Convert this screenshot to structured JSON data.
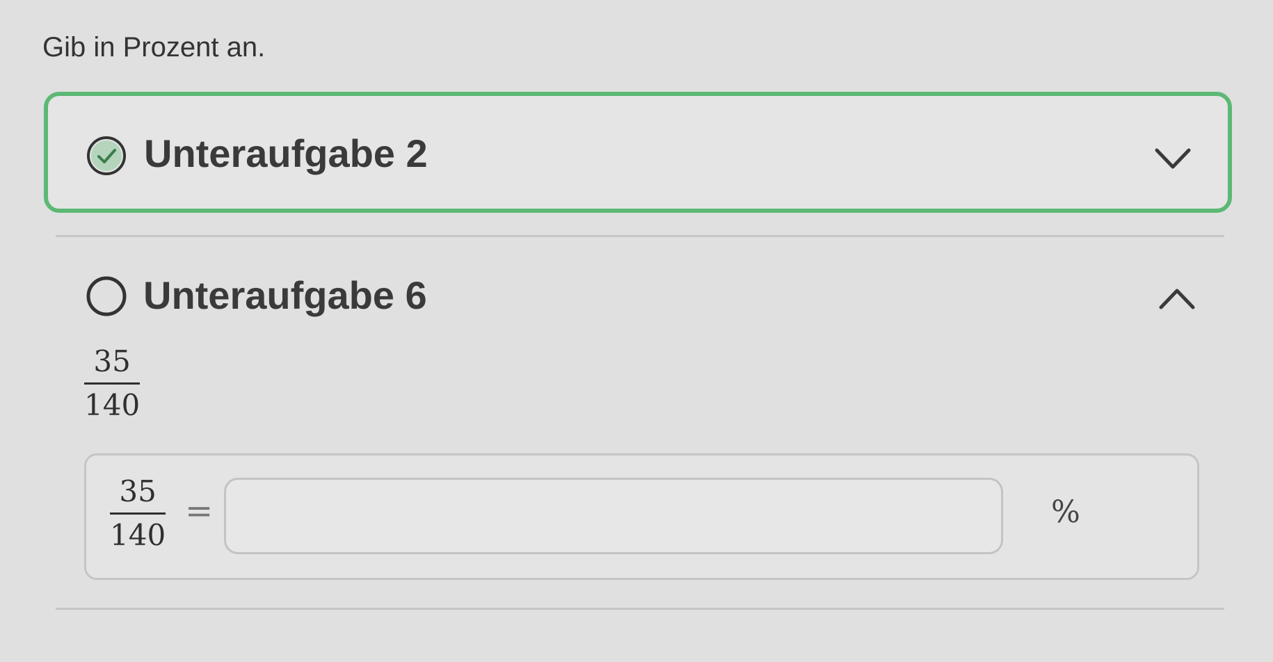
{
  "instruction": "Gib in Prozent an.",
  "colors": {
    "success_border": "#5cb874",
    "background": "#dfe0df",
    "text": "#3a3a3a"
  },
  "subtasks": [
    {
      "title": "Unteraufgabe 2",
      "status": "completed",
      "status_icon": "check-circle-icon",
      "toggle_icon": "chevron-down-icon",
      "expanded": false
    },
    {
      "title": "Unteraufgabe 6",
      "status": "open",
      "status_icon": "empty-circle-icon",
      "toggle_icon": "chevron-up-icon",
      "expanded": true,
      "fraction": {
        "numerator": "35",
        "denominator": "140"
      },
      "equation": {
        "numerator": "35",
        "denominator": "140",
        "equals": "=",
        "input_value": "",
        "unit": "%"
      }
    }
  ]
}
